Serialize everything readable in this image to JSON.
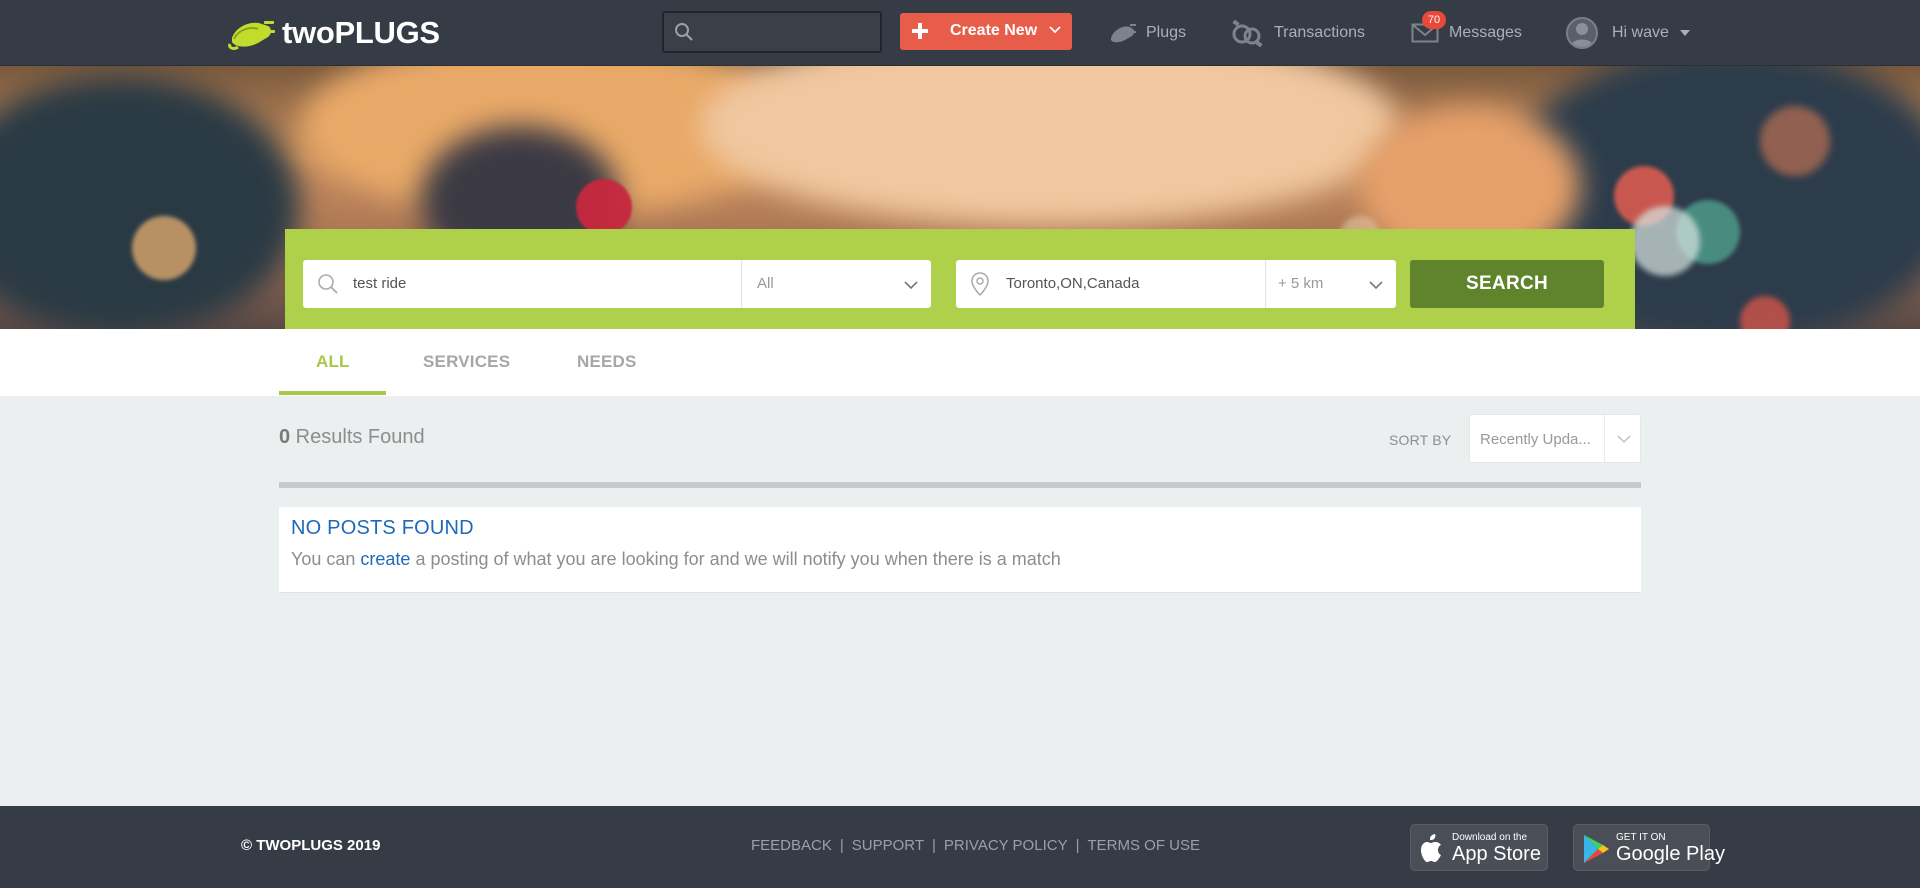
{
  "brand": {
    "name": "twoPLUGS",
    "accent": "#aed04a",
    "logo_color": "#c2dc2e"
  },
  "nav": {
    "search_placeholder": "",
    "create_label": "Create New",
    "plugs_label": "Plugs",
    "transactions_label": "Transactions",
    "messages_label": "Messages",
    "messages_badge": "70",
    "user_greeting": "Hi wave"
  },
  "search": {
    "query": "test ride",
    "category": "All",
    "location": "Toronto,ON,Canada",
    "distance": "+ 5 km",
    "button_label": "SEARCH"
  },
  "tabs": [
    {
      "label": "ALL",
      "active": true
    },
    {
      "label": "SERVICES",
      "active": false
    },
    {
      "label": "NEEDS",
      "active": false
    }
  ],
  "results": {
    "count": "0",
    "count_label": " Results Found",
    "sort_label": "SORT BY",
    "sort_value": "Recently Upda..."
  },
  "no_posts": {
    "title": "NO POSTS FOUND",
    "msg_before": "You can ",
    "msg_link": "create",
    "msg_after": " a posting of what you are looking for and we will notify you when there is a match"
  },
  "footer": {
    "copyright": "© TWOPLUGS 2019",
    "links": [
      "FEEDBACK",
      "SUPPORT",
      "PRIVACY POLICY",
      "TERMS OF USE"
    ],
    "app_store_small": "Download on the",
    "app_store_big": "App Store",
    "google_play_small": "GET IT ON",
    "google_play_big": "Google Play"
  },
  "colors": {
    "topbar": "#363c45",
    "create_button": "#e85c4a",
    "search_button": "#5f842c",
    "link_blue": "#1e6ab8",
    "badge_red": "#e8493b"
  }
}
